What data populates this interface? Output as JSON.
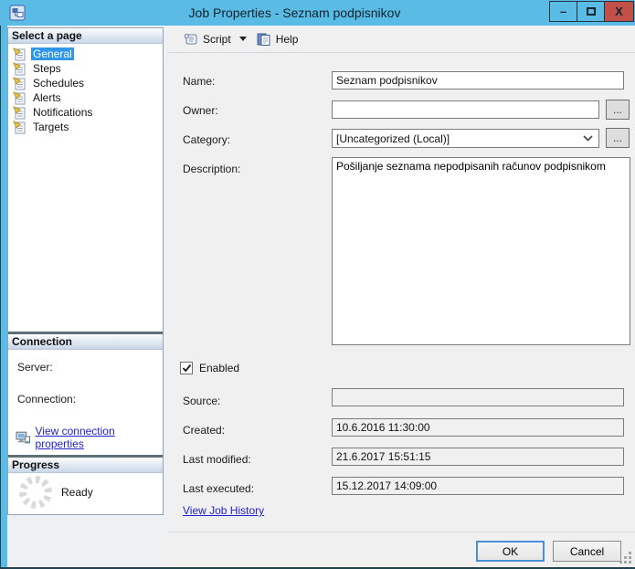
{
  "window": {
    "title": "Job Properties - Seznam podpisnikov",
    "minimize_glyph": "–",
    "close_glyph": "X"
  },
  "colors": {
    "titlebar": "#5ABCE4",
    "close_button": "#C15049",
    "selection": "#2F96E8",
    "link": "#2323CC",
    "panel_background": "#F0F0F0"
  },
  "sidebar": {
    "pages_header": "Select a page",
    "items": [
      {
        "label": "General",
        "selected": true
      },
      {
        "label": "Steps",
        "selected": false
      },
      {
        "label": "Schedules",
        "selected": false
      },
      {
        "label": "Alerts",
        "selected": false
      },
      {
        "label": "Notifications",
        "selected": false
      },
      {
        "label": "Targets",
        "selected": false
      }
    ],
    "connection": {
      "header": "Connection",
      "server_label": "Server:",
      "server_value": "",
      "connection_label": "Connection:",
      "connection_value": "",
      "link": "View connection properties"
    },
    "progress": {
      "header": "Progress",
      "status": "Ready"
    }
  },
  "toolbar": {
    "script_label": "Script",
    "help_label": "Help"
  },
  "form": {
    "name_label": "Name:",
    "name_value": "Seznam podpisnikov",
    "owner_label": "Owner:",
    "owner_value": "",
    "browse_label": "...",
    "category_label": "Category:",
    "category_value": "[Uncategorized (Local)]",
    "description_label": "Description:",
    "description_value": "Pošiljanje seznama nepodpisanih računov podpisnikom",
    "enabled_label": "Enabled",
    "enabled_checked": true,
    "source_label": "Source:",
    "source_value": "",
    "created_label": "Created:",
    "created_value": "10.6.2016 11:30:00",
    "last_modified_label": "Last modified:",
    "last_modified_value": "21.6.2017 15:51:15",
    "last_executed_label": "Last executed:",
    "last_executed_value": "15.12.2017 14:09:00",
    "history_link": "View Job History"
  },
  "footer": {
    "ok_label": "OK",
    "cancel_label": "Cancel"
  }
}
